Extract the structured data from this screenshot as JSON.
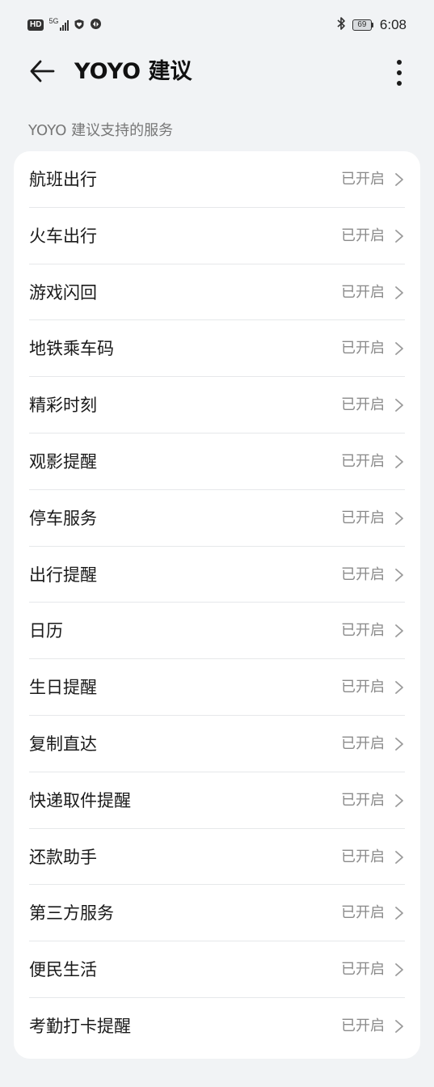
{
  "status_bar": {
    "hd_label": "HD",
    "network_label": "5G",
    "battery_level": "69",
    "time": "6:08",
    "icons": [
      "hd-icon",
      "signal-icon",
      "heart-shield-icon",
      "vpn-icon",
      "bluetooth-icon",
      "battery-icon"
    ]
  },
  "header": {
    "title": "YOYO 建议",
    "back_icon": "back-arrow-icon",
    "more_icon": "more-vertical-icon"
  },
  "section": {
    "label": "YOYO 建议支持的服务"
  },
  "services": [
    {
      "label": "航班出行",
      "status": "已开启"
    },
    {
      "label": "火车出行",
      "status": "已开启"
    },
    {
      "label": "游戏闪回",
      "status": "已开启"
    },
    {
      "label": "地铁乘车码",
      "status": "已开启"
    },
    {
      "label": "精彩时刻",
      "status": "已开启"
    },
    {
      "label": "观影提醒",
      "status": "已开启"
    },
    {
      "label": "停车服务",
      "status": "已开启"
    },
    {
      "label": "出行提醒",
      "status": "已开启"
    },
    {
      "label": "日历",
      "status": "已开启"
    },
    {
      "label": "生日提醒",
      "status": "已开启"
    },
    {
      "label": "复制直达",
      "status": "已开启"
    },
    {
      "label": "快递取件提醒",
      "status": "已开启"
    },
    {
      "label": "还款助手",
      "status": "已开启"
    },
    {
      "label": "第三方服务",
      "status": "已开启"
    },
    {
      "label": "便民生活",
      "status": "已开启"
    },
    {
      "label": "考勤打卡提醒",
      "status": "已开启"
    }
  ],
  "colors": {
    "background": "#f1f3f5",
    "card": "#ffffff",
    "status_text": "#8a8a8a",
    "divider": "#e6e8ea"
  }
}
